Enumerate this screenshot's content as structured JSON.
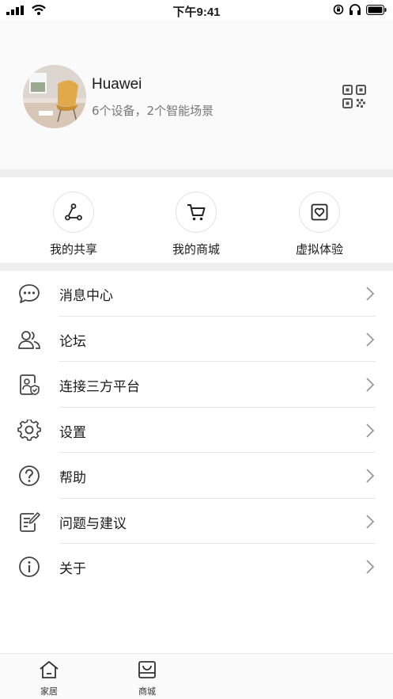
{
  "status_bar": {
    "time": "下午9:41"
  },
  "profile": {
    "name": "Huawei",
    "subtitle": "6个设备，2个智能场景"
  },
  "quick_actions": [
    {
      "label": "我的共享",
      "icon": "share-icon"
    },
    {
      "label": "我的商城",
      "icon": "cart-icon"
    },
    {
      "label": "虚拟体验",
      "icon": "heart-frame-icon"
    }
  ],
  "menu": [
    {
      "label": "消息中心",
      "icon": "message-icon"
    },
    {
      "label": "论坛",
      "icon": "users-icon"
    },
    {
      "label": "连接三方平台",
      "icon": "connect-platform-icon"
    },
    {
      "label": "设置",
      "icon": "gear-icon"
    },
    {
      "label": "帮助",
      "icon": "help-icon"
    },
    {
      "label": "问题与建议",
      "icon": "feedback-icon"
    },
    {
      "label": "关于",
      "icon": "info-icon"
    }
  ],
  "tabbar": [
    {
      "label": "家居",
      "icon": "home-icon"
    },
    {
      "label": "商城",
      "icon": "store-icon"
    }
  ]
}
